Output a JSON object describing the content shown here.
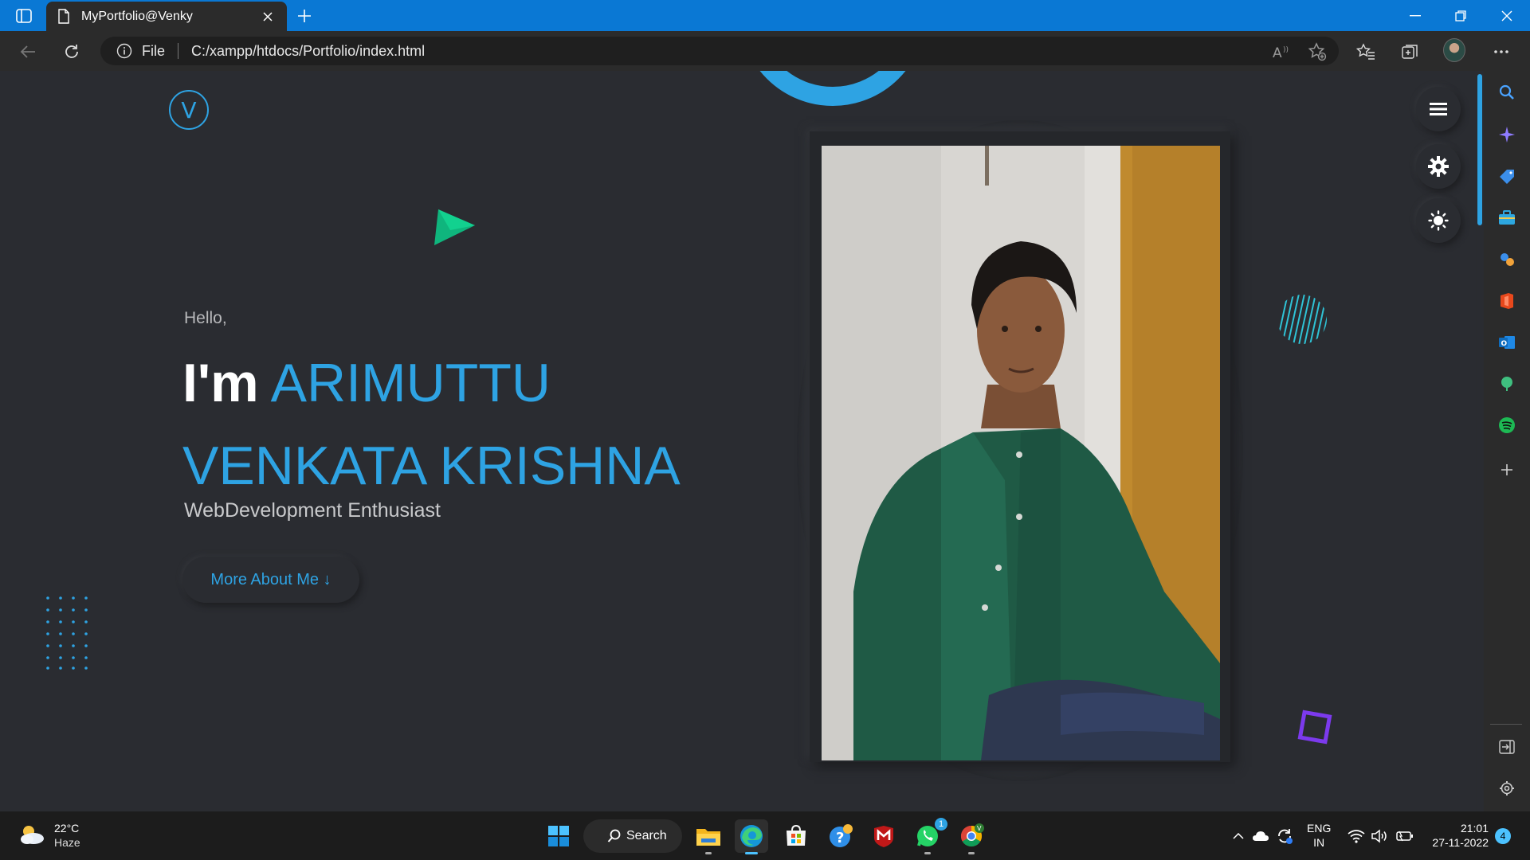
{
  "browser": {
    "tab_title": "MyPortfolio@Venky",
    "address_scheme": "File",
    "address_url": "C:/xampp/htdocs/Portfolio/index.html"
  },
  "page": {
    "logo_letter": "V",
    "greeting": "Hello,",
    "im": "I'm",
    "name_line1": "ARIMUTTU",
    "name_line2": "VENKATA KRISHNA",
    "tagline": "WebDevelopment Enthusiast",
    "about_button": "More About Me ↓",
    "accent_color": "#2ea3e3"
  },
  "icons": {
    "menu": "hamburger-icon",
    "settings": "gear-icon",
    "theme": "sun-icon"
  },
  "taskbar": {
    "weather_temp": "22°C",
    "weather_condition": "Haze",
    "search_label": "Search",
    "whatsapp_badge": "1",
    "lang_line1": "ENG",
    "lang_line2": "IN",
    "time": "21:01",
    "date": "27-11-2022",
    "notification_count": "4"
  }
}
